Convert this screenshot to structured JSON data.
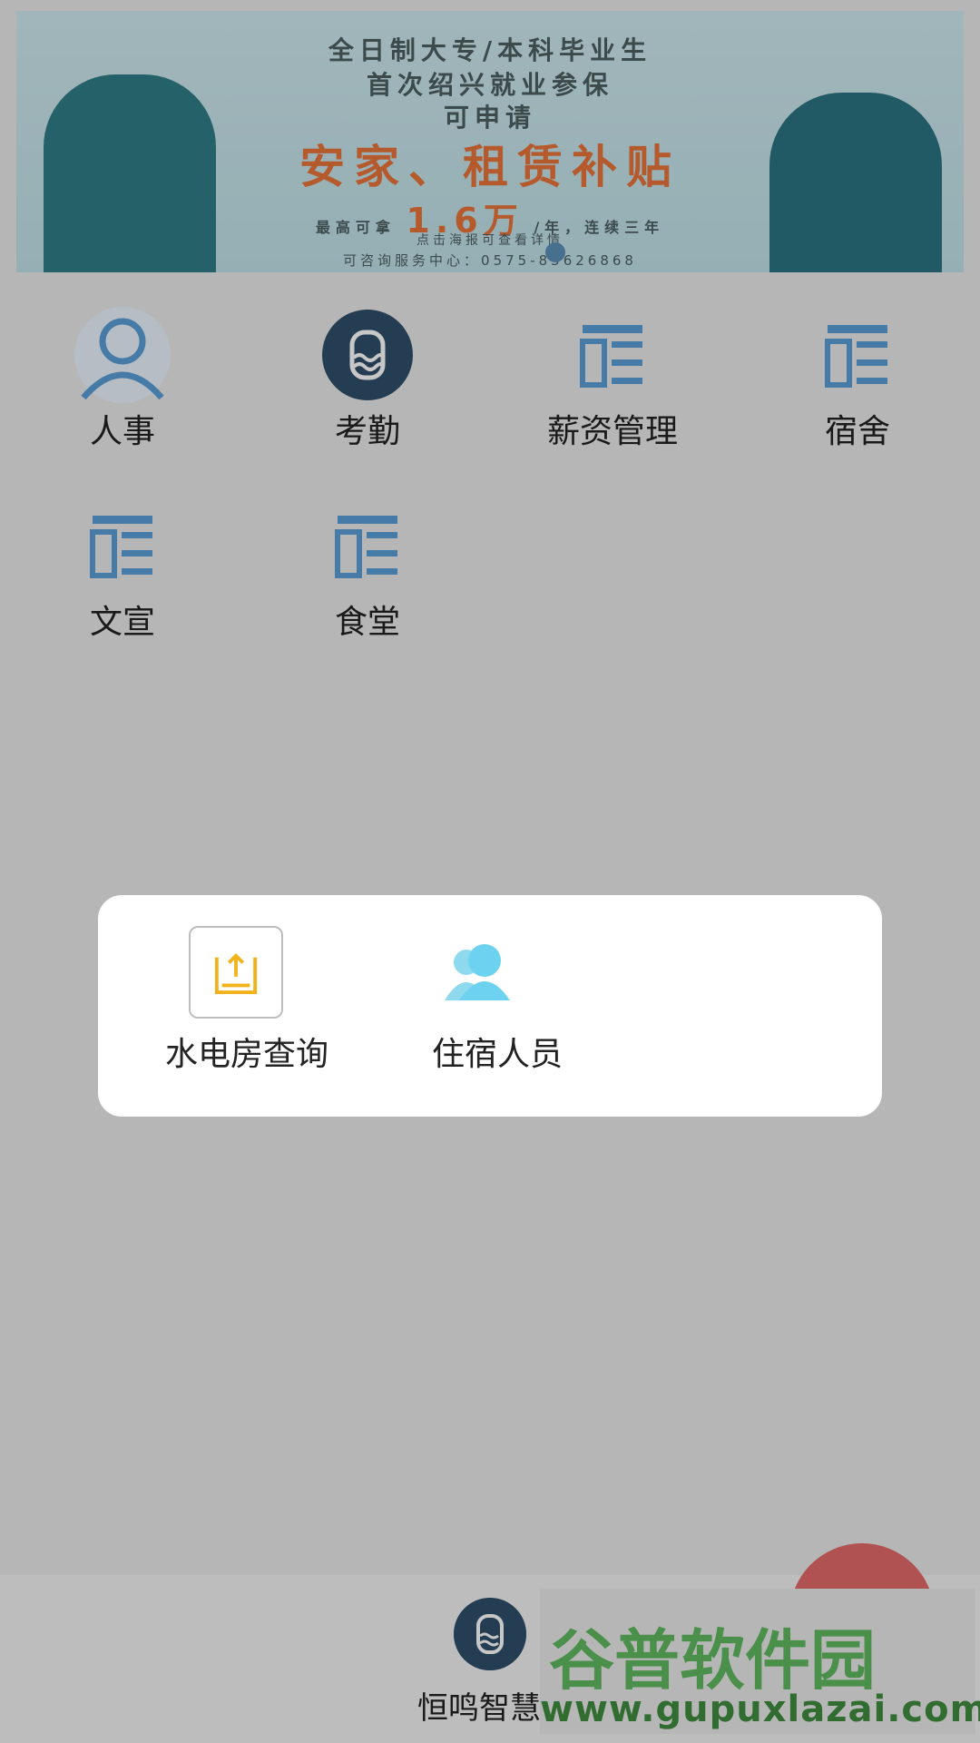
{
  "banner": {
    "line1": "全日制大专/本科毕业生",
    "line2": "首次绍兴就业参保",
    "line3": "可申请",
    "headline": "安家、租赁补贴",
    "max_prefix": "最高可拿",
    "max_amount": "1.6万",
    "max_suffix": "/年，连续三年",
    "tap_hint": "点击海报可查看详情",
    "contact": "可咨询服务中心：0575-85626868"
  },
  "menu": {
    "items": [
      {
        "label": "人事",
        "icon": "person-icon"
      },
      {
        "label": "考勤",
        "icon": "attendance-icon"
      },
      {
        "label": "薪资管理",
        "icon": "list-icon"
      },
      {
        "label": "宿舍",
        "icon": "list-icon"
      },
      {
        "label": "文宣",
        "icon": "list-icon"
      },
      {
        "label": "食堂",
        "icon": "list-icon"
      }
    ]
  },
  "modal": {
    "items": [
      {
        "label": "水电房查询",
        "icon": "upload-icon"
      },
      {
        "label": "住宿人员",
        "icon": "people-icon"
      }
    ]
  },
  "bottom": {
    "label": "恒鸣智慧"
  },
  "watermark": {
    "title": "谷普软件园",
    "url": "www.gupuxlazai.com"
  },
  "colors": {
    "accent_blue": "#5a9ed6",
    "dark_blue": "#2f4f6a",
    "orange": "#e8743a",
    "yellow": "#f2b21a",
    "light_cyan": "#6cd2ef"
  }
}
